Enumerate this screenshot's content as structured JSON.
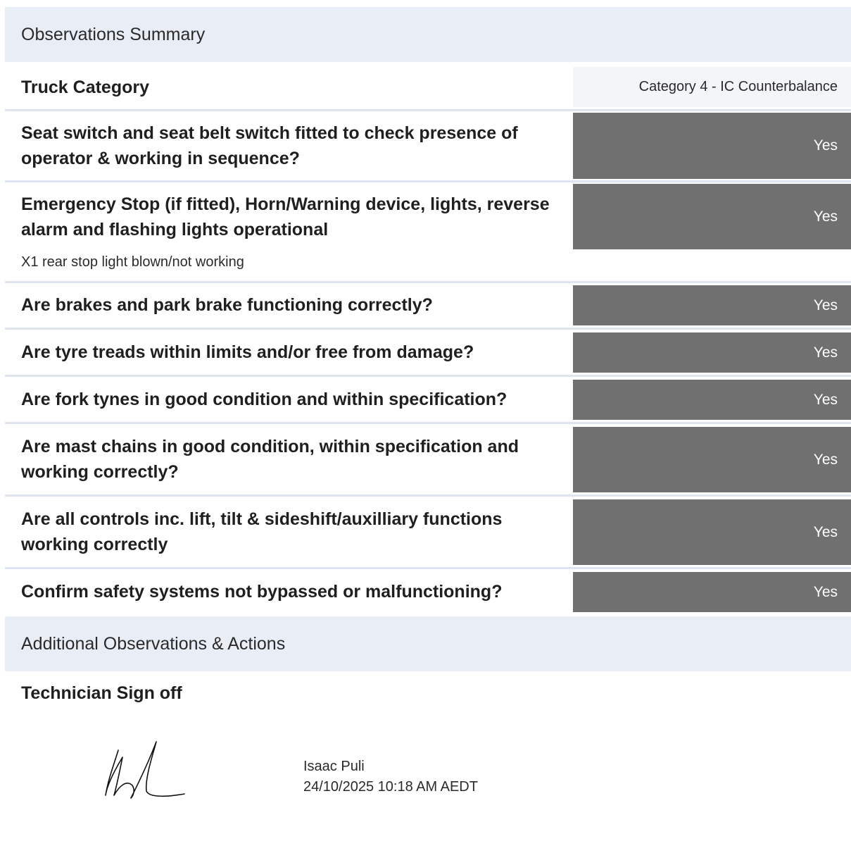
{
  "observations_header": "Observations Summary",
  "truck_category": {
    "label": "Truck Category",
    "value": "Category 4 - IC Counterbalance"
  },
  "checks": [
    {
      "question": "Seat switch and seat belt switch fitted to check presence of operator & working in sequence?",
      "answer": "Yes"
    },
    {
      "question": "Emergency Stop (if fitted), Horn/Warning device, lights, reverse alarm and flashing lights operational",
      "answer": "Yes",
      "note": "X1 rear stop light blown/not working"
    },
    {
      "question": "Are brakes and park brake functioning correctly?",
      "answer": "Yes"
    },
    {
      "question": "Are tyre treads within limits and/or free from damage?",
      "answer": "Yes"
    },
    {
      "question": "Are fork tynes in good condition and within specification?",
      "answer": "Yes"
    },
    {
      "question": "Are mast chains in good condition, within specification and working correctly?",
      "answer": "Yes"
    },
    {
      "question": "Are all controls inc. lift, tilt & sideshift/auxilliary functions working correctly",
      "answer": "Yes"
    },
    {
      "question": "Confirm safety systems not bypassed or malfunctioning?",
      "answer": "Yes"
    }
  ],
  "additional_header": "Additional Observations & Actions",
  "signoff": {
    "title": "Technician Sign off",
    "name": "Isaac Puli",
    "datetime": "24/10/2025 10:18 AM AEDT"
  },
  "colors": {
    "header_bg": "#e8edf6",
    "answer_bg": "#707070",
    "answer_text": "#ffffff"
  }
}
